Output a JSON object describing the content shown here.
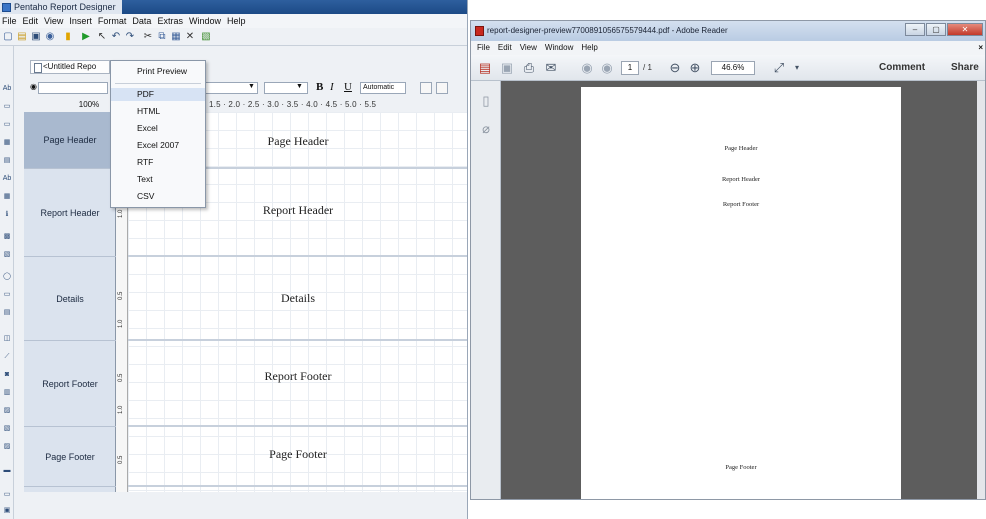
{
  "pentaho": {
    "title": "Pentaho Report Designer",
    "menu": [
      "File",
      "Edit",
      "View",
      "Insert",
      "Format",
      "Data",
      "Extras",
      "Window",
      "Help"
    ],
    "doc_tab": "<Untitled Repo",
    "zoom": "100%",
    "ruler": "1.5 · 2.0 · 2.5 · 3.0 · 3.5 · 4.0 · 4.5 · 5.0 · 5.5",
    "font_color": "Automatic",
    "bands": [
      {
        "label": "Page Header",
        "content": "Page Header"
      },
      {
        "label": "Report Header",
        "content": "Report Header"
      },
      {
        "label": "Details",
        "content": "Details"
      },
      {
        "label": "Report Footer",
        "content": "Report Footer"
      },
      {
        "label": "Page Footer",
        "content": "Page Footer"
      }
    ],
    "vruler_ticks": [
      "0.5",
      "1.0",
      "1.5"
    ],
    "dropdown": {
      "items": [
        "Print Preview",
        "PDF",
        "HTML",
        "Excel",
        "Excel 2007",
        "RTF",
        "Text",
        "CSV"
      ],
      "highlighted": "PDF"
    }
  },
  "reader": {
    "title": "report-designer-preview7700891056575579444.pdf - Adobe Reader",
    "menu": [
      "File",
      "Edit",
      "View",
      "Window",
      "Help"
    ],
    "page_current": "1",
    "page_total": "/ 1",
    "zoom": "46.6%",
    "comment": "Comment",
    "share": "Share",
    "page_texts": {
      "page_header": "Page Header",
      "report_header": "Report Header",
      "report_footer": "Report Footer",
      "page_footer": "Page Footer"
    }
  },
  "icons": {
    "fmt_bold": "B",
    "fmt_italic": "I",
    "fmt_underline": "U"
  }
}
